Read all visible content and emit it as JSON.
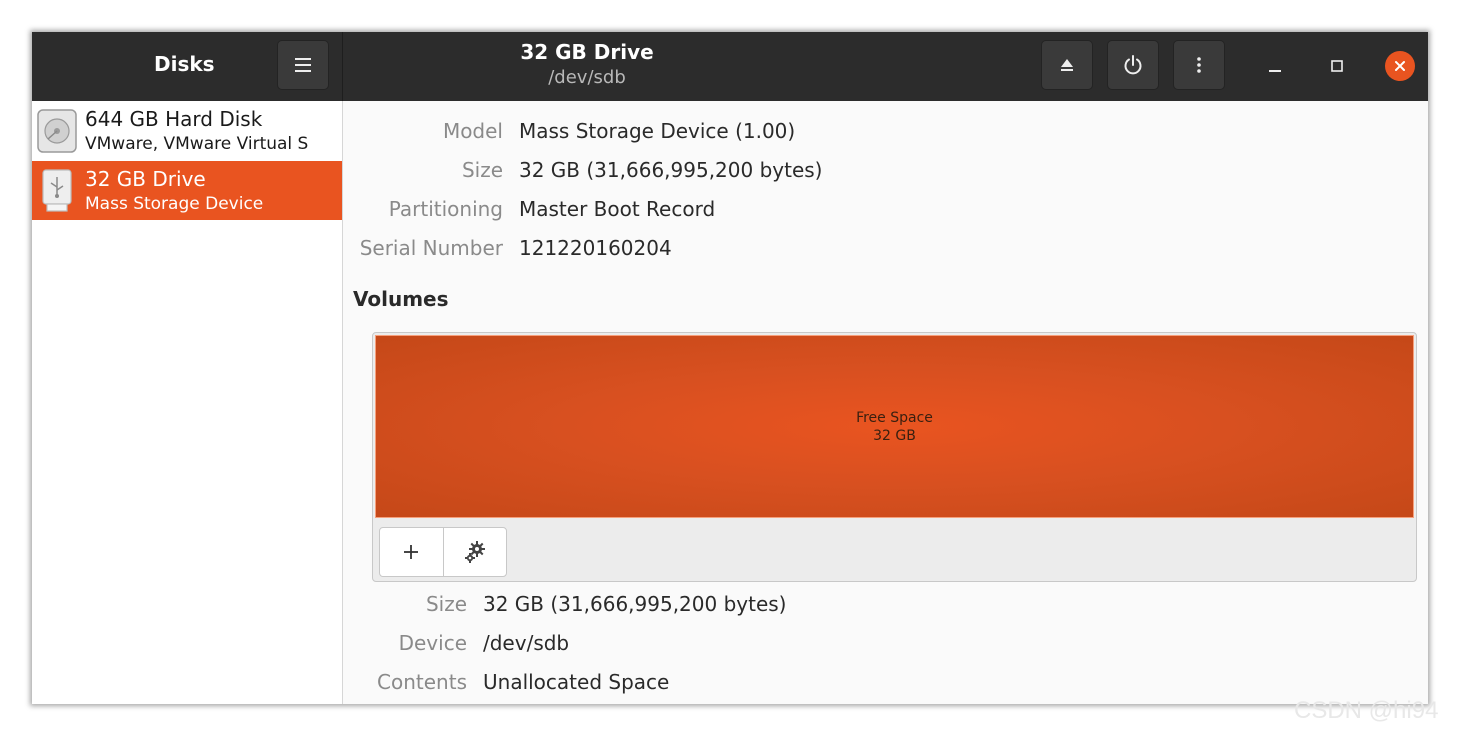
{
  "header": {
    "app_title": "Disks",
    "window_title": "32 GB Drive",
    "window_subtitle": "/dev/sdb",
    "icons": {
      "menu": "hamburger-menu-icon",
      "eject": "eject-icon",
      "power": "power-icon",
      "more": "vertical-ellipsis-icon",
      "minimize": "minimize-icon",
      "maximize": "maximize-icon",
      "close": "close-icon"
    }
  },
  "sidebar": {
    "disks": [
      {
        "name": "644 GB Hard Disk",
        "subtitle": "VMware, VMware Virtual S",
        "icon": "hard-disk-icon",
        "selected": false
      },
      {
        "name": "32 GB Drive",
        "subtitle": "Mass Storage Device",
        "icon": "usb-drive-icon",
        "selected": true
      }
    ]
  },
  "drive": {
    "model_label": "Model",
    "model": "Mass Storage Device (1.00)",
    "size_label": "Size",
    "size": "32 GB (31,666,995,200 bytes)",
    "partitioning_label": "Partitioning",
    "partitioning": "Master Boot Record",
    "serial_label": "Serial Number",
    "serial": "121220160204"
  },
  "volumes": {
    "heading": "Volumes",
    "segments": [
      {
        "name": "Free Space",
        "size": "32 GB"
      }
    ],
    "tools": {
      "add_icon": "plus-icon",
      "settings_icon": "gears-icon"
    }
  },
  "volume_details": {
    "size_label": "Size",
    "size": "32 GB (31,666,995,200 bytes)",
    "device_label": "Device",
    "device": "/dev/sdb",
    "contents_label": "Contents",
    "contents": "Unallocated Space"
  },
  "watermark": "CSDN @hi94",
  "colors": {
    "accent": "#e95420",
    "header_bg": "#2c2c2c",
    "label": "#8a8a8a"
  }
}
